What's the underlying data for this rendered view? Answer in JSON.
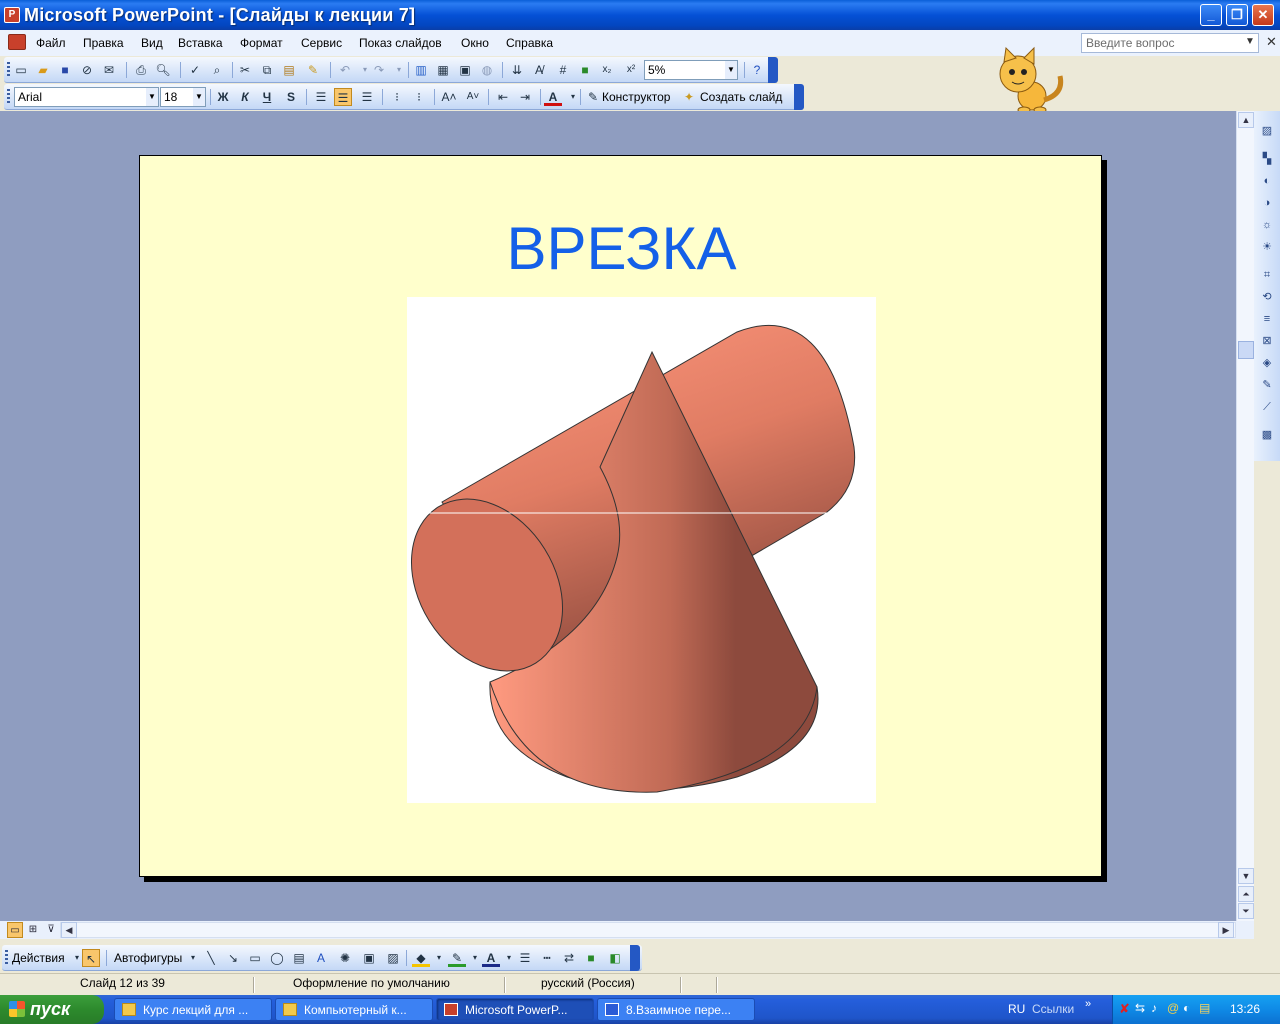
{
  "window": {
    "title": "Microsoft PowerPoint - [Слайды к лекции 7]",
    "controls": [
      "_",
      "❐",
      "✕"
    ]
  },
  "menu": {
    "items": [
      "Файл",
      "Правка",
      "Вид",
      "Вставка",
      "Формат",
      "Сервис",
      "Показ слайдов",
      "Окно",
      "Справка"
    ],
    "help_placeholder": "Введите вопрос"
  },
  "toolbar_standard": {
    "zoom": "5%"
  },
  "toolbar_formatting": {
    "font": "Arial",
    "size": "18",
    "bold": "Ж",
    "italic": "К",
    "underline": "Ч",
    "shadow": "S",
    "designer_label": "Конструктор",
    "new_slide_label": "Создать слайд"
  },
  "slide": {
    "title": "ВРЕЗКА",
    "background": "#ffffcc",
    "title_color": "#1460e8",
    "shape_color": "#e8836a"
  },
  "drawing_toolbar": {
    "actions_label": "Действия",
    "autoshapes_label": "Автофигуры"
  },
  "status": {
    "slide": "Слайд 12 из 39",
    "design": "Оформление по умолчанию",
    "language": "русский (Россия)"
  },
  "taskbar": {
    "start_label": "пуск",
    "tasks": [
      "Курс лекций для ...",
      "Компьютерный к...",
      "Microsoft PowerP...",
      "8.Взаимное пере..."
    ],
    "lang": "RU",
    "links": "Ссылки",
    "clock": "13:26"
  }
}
